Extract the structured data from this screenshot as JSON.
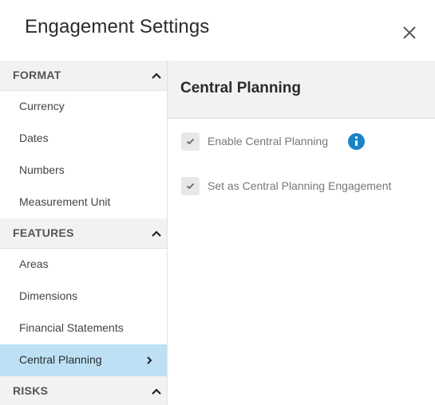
{
  "dialog": {
    "title": "Engagement Settings",
    "close_icon": "close-icon"
  },
  "sidebar": {
    "sections": [
      {
        "label": "FORMAT",
        "expanded": true,
        "items": [
          {
            "label": "Currency"
          },
          {
            "label": "Dates"
          },
          {
            "label": "Numbers"
          },
          {
            "label": "Measurement Unit"
          }
        ]
      },
      {
        "label": "FEATURES",
        "expanded": true,
        "items": [
          {
            "label": "Areas"
          },
          {
            "label": "Dimensions"
          },
          {
            "label": "Financial Statements"
          },
          {
            "label": "Central Planning",
            "active": true
          }
        ]
      },
      {
        "label": "RISKS",
        "expanded": true,
        "items": []
      }
    ]
  },
  "main": {
    "title": "Central Planning",
    "options": [
      {
        "label": "Enable Central Planning",
        "checked": true,
        "disabled": true,
        "has_info": true
      },
      {
        "label": "Set as Central Planning Engagement",
        "checked": true,
        "disabled": true,
        "has_info": false
      }
    ]
  },
  "colors": {
    "active_item_bg": "#bde0f5",
    "info_icon": "#1a84c6",
    "section_bg": "#f2f2f2"
  }
}
